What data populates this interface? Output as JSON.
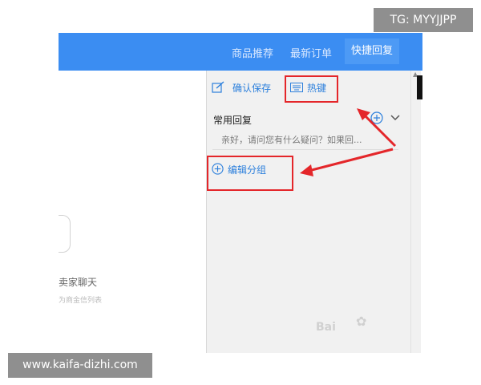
{
  "watermarks": {
    "tg": "TG: MYYJJPP",
    "url": "www.kaifa-dizhi.com"
  },
  "header": {
    "tabs": [
      {
        "label": "商品推荐",
        "active": false
      },
      {
        "label": "最新订单",
        "active": false
      },
      {
        "label": "快捷回复",
        "active": true
      }
    ]
  },
  "toolbar": {
    "confirm_save": "确认保存",
    "hotkey": "热键"
  },
  "group": {
    "title": "常用回复",
    "reply_text": "亲好，请问您有什么疑问？如果回..."
  },
  "edit_group": "编辑分组",
  "left_partial": {
    "text1": "卖家聊天",
    "text2": "为商金信列表"
  },
  "baidu_watermark": "Bai",
  "colors": {
    "accent": "#3b8df2",
    "link": "#2b7fdc",
    "annotation": "#e4262a"
  }
}
